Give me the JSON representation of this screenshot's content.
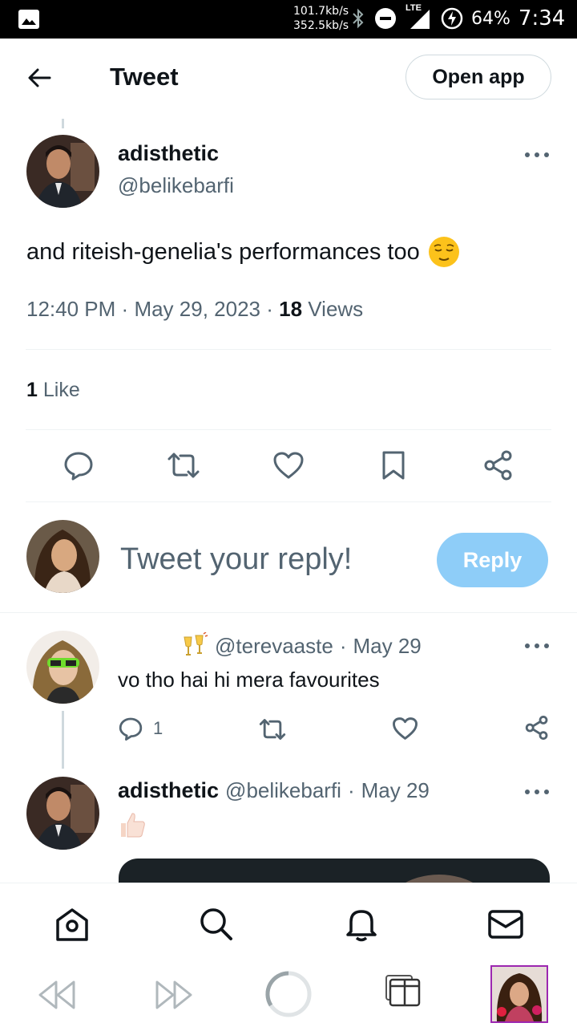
{
  "status_bar": {
    "speed_down": "101.7kb/s",
    "speed_up": "352.5kb/s",
    "network": "LTE",
    "battery": "64%",
    "time": "7:34"
  },
  "header": {
    "title": "Tweet",
    "open_app_label": "Open app"
  },
  "tweet": {
    "author_name": "adisthetic",
    "author_handle": "@belikebarfi",
    "text": "and riteish-genelia's performances too",
    "emoji": "😌",
    "time": "12:40 PM",
    "date": "May 29, 2023",
    "views_count": "18",
    "views_label": "Views",
    "likes_count": "1",
    "likes_label": "Like"
  },
  "composer": {
    "placeholder": "Tweet your reply!",
    "reply_label": "Reply"
  },
  "replies": [
    {
      "emoji_name": "🥂",
      "handle": "@terevaaste",
      "date": "May 29",
      "text": "vo tho hai hi mera favourites",
      "reply_count": "1"
    },
    {
      "name": "adisthetic",
      "handle": "@belikebarfi",
      "date": "May 29",
      "text": "👍🏻"
    }
  ],
  "separator": "·",
  "colors": {
    "text_primary": "#0f1419",
    "text_secondary": "#536471",
    "reply_button": "#8ecdf8",
    "divider": "#eff3f4"
  },
  "icons": [
    "back-arrow-icon",
    "more-icon",
    "reply-icon",
    "retweet-icon",
    "like-icon",
    "bookmark-icon",
    "share-icon",
    "home-icon",
    "search-icon",
    "notifications-icon",
    "messages-icon"
  ]
}
